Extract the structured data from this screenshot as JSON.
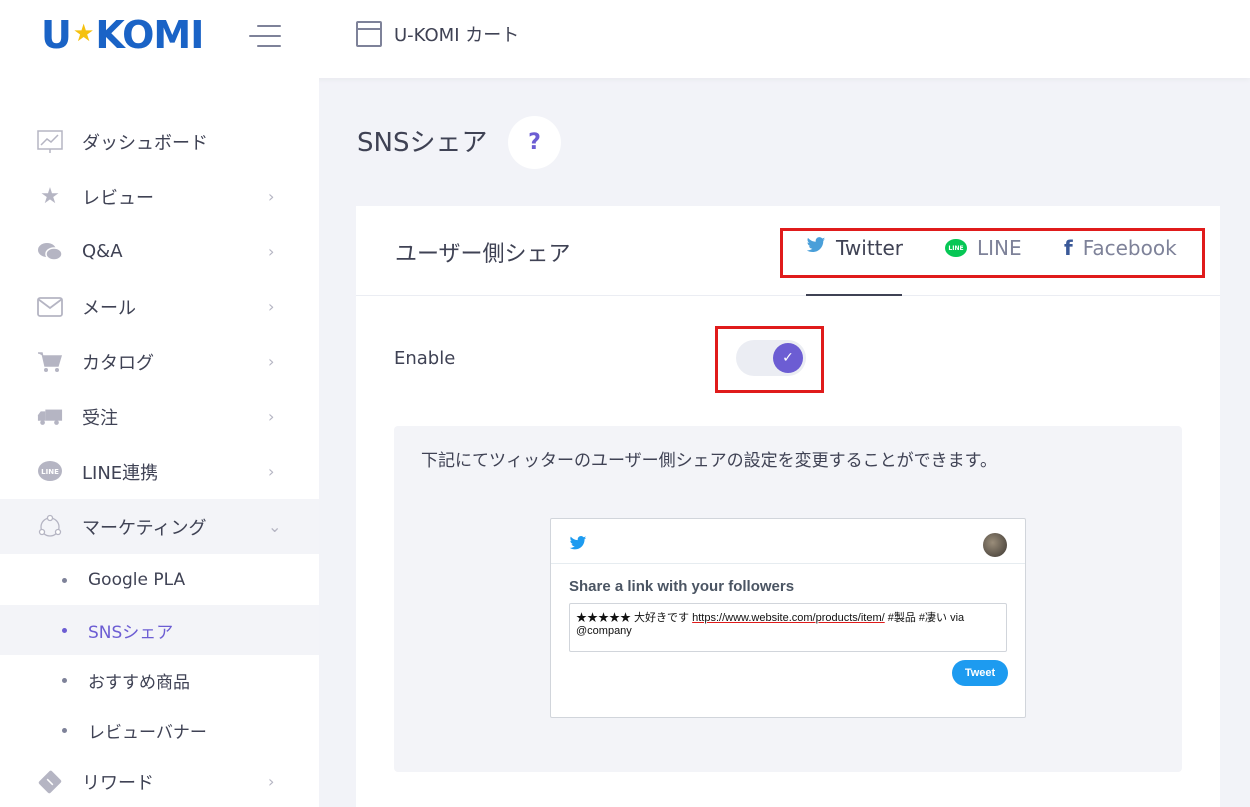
{
  "header": {
    "logo_left": "U",
    "logo_star": "★",
    "logo_right": "KOMI",
    "shop_name": "U-KOMI カート"
  },
  "sidebar": {
    "items": [
      {
        "label": "ダッシュボード",
        "icon": "chart-icon",
        "arrow": ""
      },
      {
        "label": "レビュー",
        "icon": "star-icon",
        "arrow": "›"
      },
      {
        "label": "Q&A",
        "icon": "chat-icon",
        "arrow": "›"
      },
      {
        "label": "メール",
        "icon": "mail-icon",
        "arrow": "›"
      },
      {
        "label": "カタログ",
        "icon": "cart-icon",
        "arrow": "›"
      },
      {
        "label": "受注",
        "icon": "truck-icon",
        "arrow": "›"
      },
      {
        "label": "LINE連携",
        "icon": "line-icon",
        "arrow": "›"
      },
      {
        "label": "マーケティング",
        "icon": "network-icon",
        "arrow": "⌄"
      },
      {
        "label": "リワード",
        "icon": "ticket-icon",
        "arrow": "›"
      }
    ],
    "sub_items": [
      {
        "label": "Google PLA"
      },
      {
        "label": "SNSシェア"
      },
      {
        "label": "おすすめ商品"
      },
      {
        "label": "レビューバナー"
      }
    ]
  },
  "page": {
    "title": "SNSシェア",
    "help_icon": "?"
  },
  "card": {
    "title": "ユーザー側シェア",
    "tabs": [
      {
        "label": "Twitter",
        "icon": "twitter-icon"
      },
      {
        "label": "LINE",
        "icon": "line-icon"
      },
      {
        "label": "Facebook",
        "icon": "facebook-icon"
      }
    ],
    "line_icon_text": "LINE",
    "facebook_icon_text": "f",
    "enable_label": "Enable",
    "toggle_checked": true,
    "check_mark": "✓",
    "info_text": "下記にてツィッターのユーザー側シェアの設定を変更することができます。"
  },
  "tweet_preview": {
    "heading": "Share a link with your followers",
    "text_prefix": "★★★★★ 大好きです ",
    "text_url": "https://www.website.com/products/item/",
    "text_suffix": " #製品 #凄い via @company",
    "button_label": "Tweet"
  },
  "colors": {
    "accent": "#6c5dd3",
    "highlight_border": "#e01b1b",
    "twitter_blue": "#1d9bf0",
    "line_green": "#06c755",
    "facebook_blue": "#3b5998",
    "logo_blue": "#1a63c6",
    "logo_star": "#f5c10f"
  }
}
